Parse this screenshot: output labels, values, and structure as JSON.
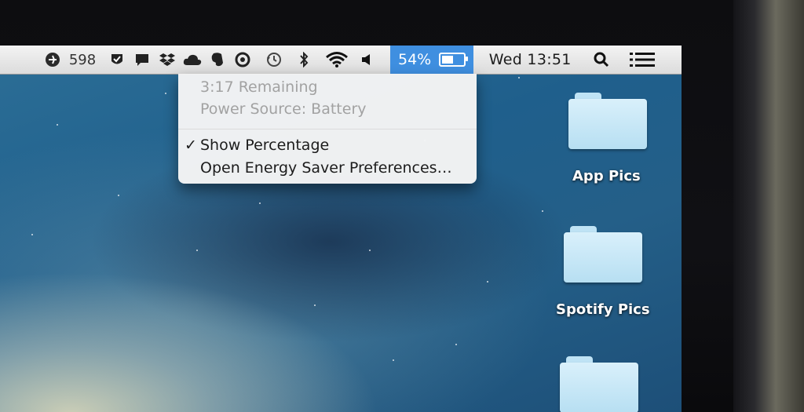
{
  "menubar": {
    "counter": "598",
    "icons": [
      "airplane-icon",
      "tick-shield-icon",
      "chat-icon",
      "dropbox-icon",
      "cloud-icon",
      "evernote-icon",
      "circle-app-icon",
      "time-machine-icon",
      "bluetooth-icon",
      "wifi-icon",
      "volume-icon"
    ],
    "battery_percent_label": "54%",
    "battery_level": 0.54,
    "clock": "Wed 13:51",
    "search_icon": "spotlight-icon",
    "notifications_icon": "list-icon"
  },
  "battery_menu": {
    "remaining": "3:17 Remaining",
    "power_source": "Power Source: Battery",
    "checkmark": "✓",
    "show_percentage": "Show Percentage",
    "energy_saver": "Open Energy Saver Preferences…"
  },
  "desktop": {
    "folders": [
      {
        "label": "App Pics"
      },
      {
        "label": "Spotify Pics"
      },
      {
        "label": ""
      }
    ]
  },
  "colors": {
    "highlight": "#3f8fe0",
    "menubar": "#e6e6e6",
    "folder": "#c9e8f8"
  }
}
